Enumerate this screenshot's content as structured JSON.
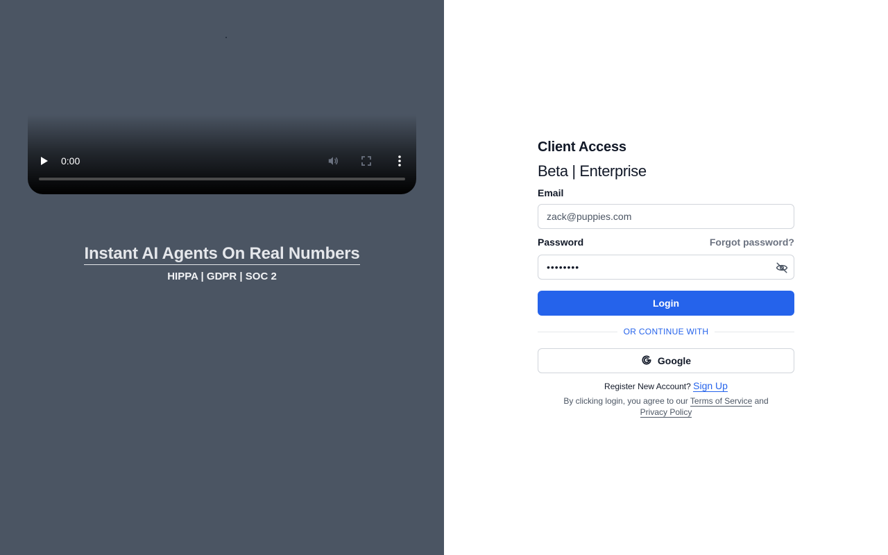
{
  "video": {
    "time": "0:00",
    "progress": 0,
    "play_icon": "play-icon",
    "volume_icon": "volume-icon",
    "fullscreen_icon": "fullscreen-icon",
    "more_icon": "more-vert-icon"
  },
  "promo": {
    "title": "Instant AI Agents On Real Numbers",
    "subtitle": "HIPPA | GDPR | SOC 2"
  },
  "form": {
    "title": "Client Access",
    "subtitle": "Beta | Enterprise",
    "email_label": "Email",
    "email_value": "zack@puppies.com",
    "password_label": "Password",
    "forgot_label": "Forgot password?",
    "password_value": "••••••••",
    "login_label": "Login",
    "divider_label": "OR CONTINUE WITH",
    "google_label": "Google",
    "register_text": "Register New Account?",
    "signup_label": "Sign Up",
    "terms_prefix": "By clicking login, you agree to our",
    "terms_link": "Terms of Service",
    "terms_and": "and",
    "privacy_link": "Privacy Policy"
  },
  "colors": {
    "left_bg": "#4b5563",
    "accent": "#2563eb"
  }
}
